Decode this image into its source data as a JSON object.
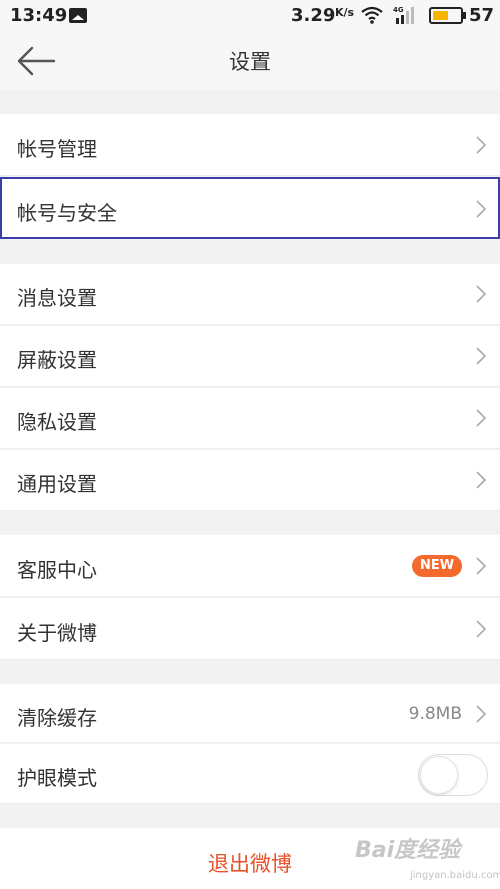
{
  "status_bar": {
    "time": "13:49",
    "speed": "3.29",
    "speed_unit": "K/s",
    "network": "4G",
    "battery": "57"
  },
  "header": {
    "title": "设置",
    "back_icon": "arrow-left-icon"
  },
  "sections": [
    {
      "items": [
        {
          "label": "帐号管理"
        },
        {
          "label": "帐号与安全",
          "highlighted": true
        }
      ]
    },
    {
      "items": [
        {
          "label": "消息设置"
        },
        {
          "label": "屏蔽设置"
        },
        {
          "label": "隐私设置"
        },
        {
          "label": "通用设置"
        }
      ]
    },
    {
      "items": [
        {
          "label": "客服中心",
          "badge": "NEW"
        },
        {
          "label": "关于微博"
        }
      ]
    },
    {
      "items": [
        {
          "label": "清除缓存",
          "value": "9.8MB"
        },
        {
          "label": "护眼模式",
          "toggle": false
        }
      ]
    }
  ],
  "logout_label": "退出微博",
  "watermark": {
    "text": "Bai度经验",
    "sub": "jingyan.baidu.com"
  },
  "colors": {
    "accent": "#e8522a",
    "badge": "#f36a2c",
    "focus_border": "#3b3ea8",
    "battery": "#f6b400"
  }
}
